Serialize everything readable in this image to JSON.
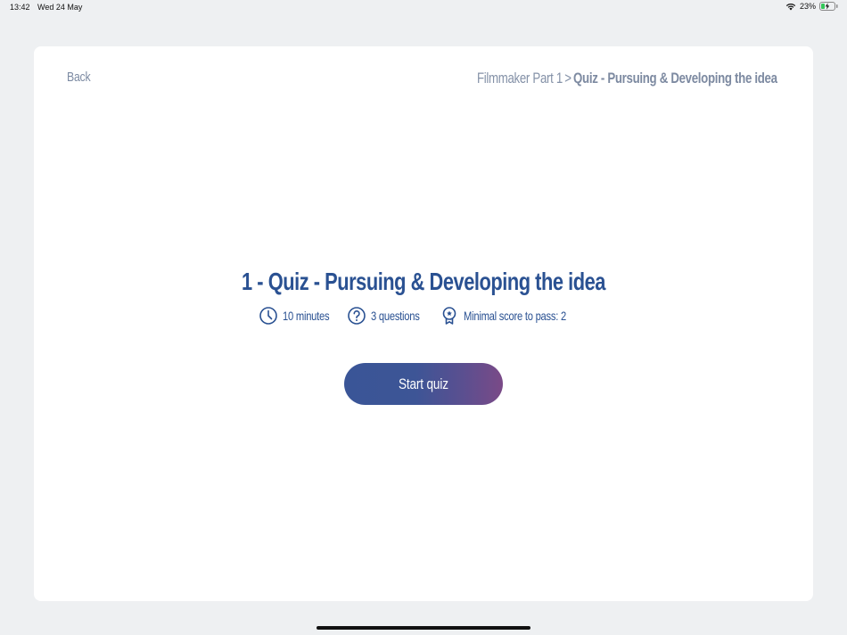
{
  "status_bar": {
    "time": "13:42",
    "date": "Wed 24 May",
    "battery_percent": "23%",
    "battery_level": 0.23,
    "charging": true
  },
  "header": {
    "back_label": "Back",
    "breadcrumb": {
      "parent": "Filmmaker Part 1",
      "separator": ">",
      "current": "Quiz - Pursuing & Developing the idea"
    }
  },
  "quiz": {
    "title": "1 - Quiz - Pursuing & Developing the idea",
    "duration": {
      "icon": "clock-icon",
      "label": "10 minutes"
    },
    "questions": {
      "icon": "question-circle-icon",
      "label": "3 questions"
    },
    "min_score": {
      "icon": "award-badge-icon",
      "label": "Minimal score to pass: 2"
    },
    "start_label": "Start quiz"
  },
  "colors": {
    "background": "#eef0f2",
    "card": "#ffffff",
    "primary_text": "#2a5192",
    "muted_text": "#8491a7",
    "button_gradient_start": "#3a5597",
    "button_gradient_end": "#7a4a87"
  }
}
